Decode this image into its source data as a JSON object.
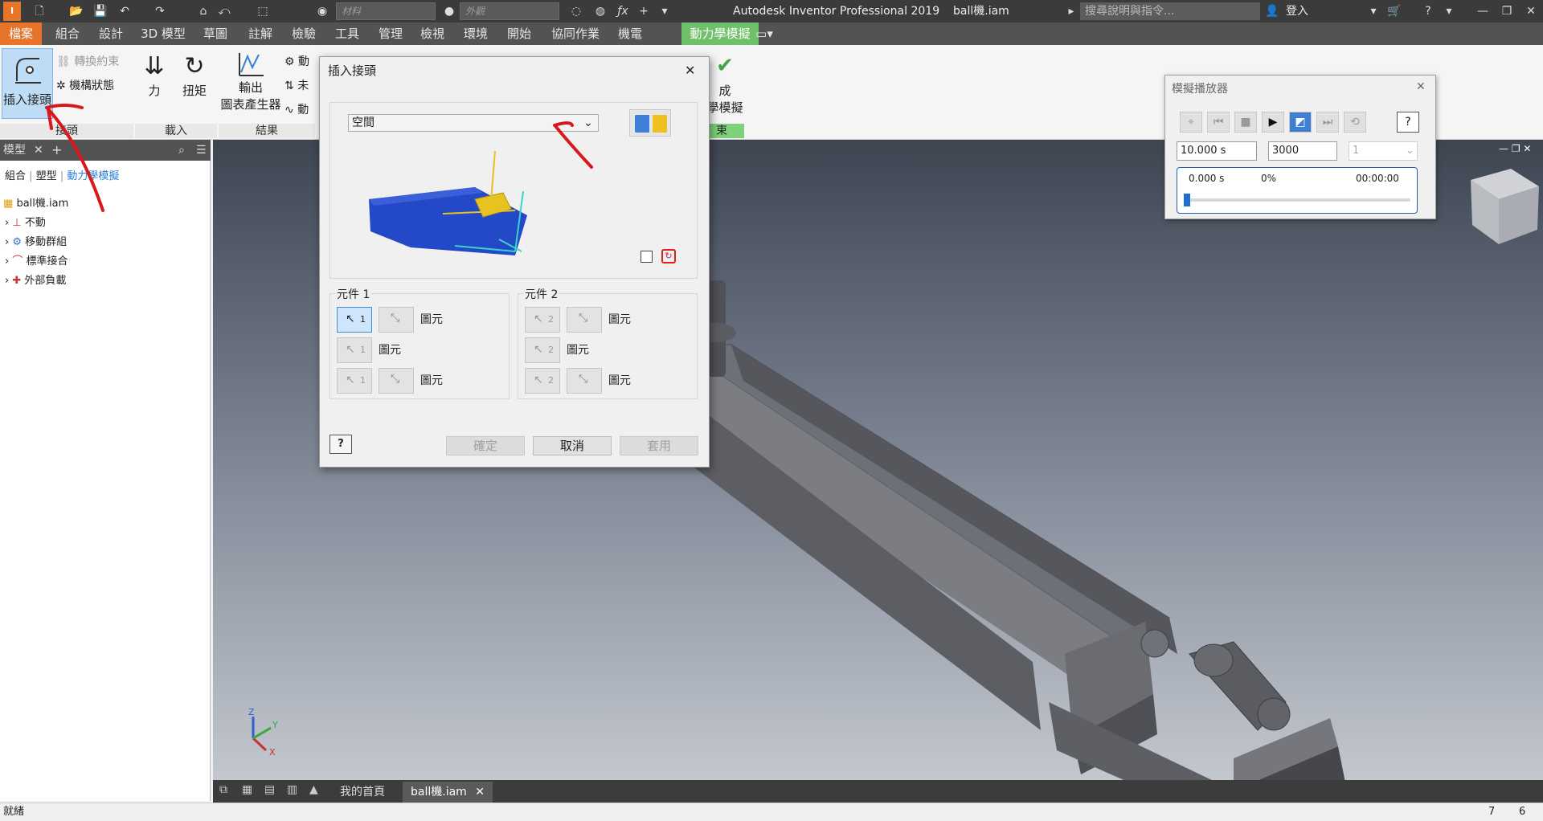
{
  "titlebar": {
    "app_title": "Autodesk Inventor Professional 2019",
    "doc_name": "ball機.iam",
    "combo1": "材料",
    "combo2": "外觀",
    "search_placeholder": "搜尋說明與指令...",
    "login": "登入"
  },
  "tabs": [
    "檔案",
    "組合",
    "設計",
    "3D 模型",
    "草圖",
    "註解",
    "檢驗",
    "工具",
    "管理",
    "檢視",
    "環境",
    "開始",
    "協同作業",
    "機電",
    "動力學模擬"
  ],
  "ribbon": {
    "insert_joint": "插入接頭",
    "convert_constraint": "轉換約束",
    "mechanism_status": "機構狀態",
    "force": "力",
    "torque": "扭矩",
    "output": "輸出",
    "grapher": "圖表產生器",
    "r1": "動",
    "r2": "未",
    "r3": "動",
    "finish_1": "成",
    "finish_2": "學模擬",
    "group_joint": "接頭",
    "group_load": "載入",
    "group_result": "結果",
    "group_end": "束"
  },
  "browser": {
    "title": "模型",
    "add": "+",
    "filter_assembly": "組合",
    "filter_model": "塑型",
    "filter_dynamic": "動力學模擬",
    "root": "ball機.iam",
    "items": [
      "不動",
      "移動群組",
      "標準接合",
      "外部負載"
    ]
  },
  "dialog": {
    "title": "插入接頭",
    "joint_type": "空間",
    "comp1_title": "元件 1",
    "comp2_title": "元件 2",
    "entity": "圖元",
    "sel1": "1",
    "sel2": "2",
    "ok": "確定",
    "cancel": "取消",
    "apply": "套用"
  },
  "player": {
    "title": "模擬播放器",
    "end_time": "10.000 s",
    "images": "3000",
    "filter": "1",
    "cur_time": "0.000 s",
    "percent": "0%",
    "elapsed": "00:00:00",
    "progress": 0
  },
  "doctabs": {
    "home": "我的首頁",
    "doc": "ball機.iam"
  },
  "status": {
    "left": "就緒",
    "r1": "7",
    "r2": "6"
  }
}
